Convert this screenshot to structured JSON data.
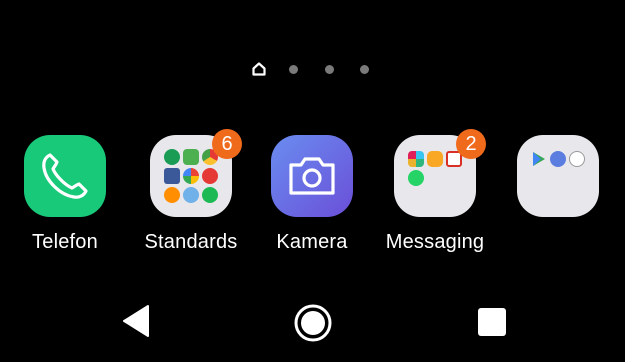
{
  "pager": {
    "pages": [
      "home",
      "page-2",
      "page-3",
      "page-4"
    ],
    "active_index": 0
  },
  "apps": [
    {
      "name": "Telefon",
      "icon": "phone-icon",
      "badge": null
    },
    {
      "name": "Standards",
      "icon": "folder-icon",
      "badge": "6"
    },
    {
      "name": "Kamera",
      "icon": "camera-icon",
      "badge": null
    },
    {
      "name": "Messaging",
      "icon": "folder-icon",
      "badge": "2"
    },
    {
      "name": "",
      "icon": "folder-icon",
      "badge": null
    }
  ],
  "navigation": {
    "back": "back-triangle-icon",
    "home": "home-circle-icon",
    "recents": "recents-square-icon"
  },
  "colors": {
    "background": "#000000",
    "phone_green": "#19c97a",
    "camera_gradient_start": "#6a8df0",
    "camera_gradient_end": "#6a4fd8",
    "badge_orange": "#f06a1c",
    "folder_bg": "#e8e8ec"
  }
}
